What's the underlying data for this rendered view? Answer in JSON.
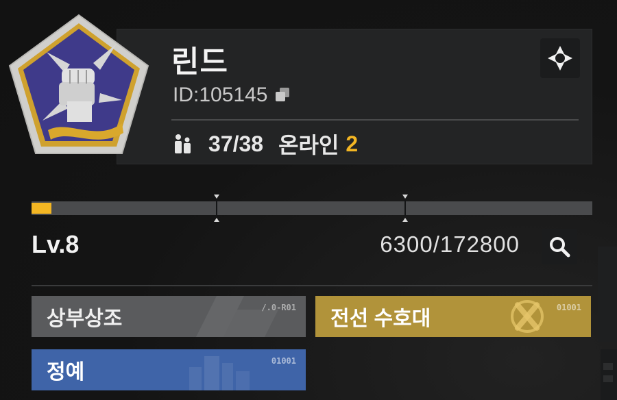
{
  "guild": {
    "name": "린드",
    "id_label": "ID:",
    "id_value": "105145",
    "members": "37/38",
    "online_label": "온라인",
    "online_count": "2"
  },
  "level": {
    "label": "Lv.8",
    "xp": "6300/172800",
    "xp_fraction": 0.036
  },
  "tags": [
    {
      "label": "상부상조",
      "code": "/.0-R01",
      "color": "#5a5b5d"
    },
    {
      "label": "전선 수호대",
      "code": "01001",
      "color": "#b1933a"
    },
    {
      "label": "정예",
      "code": "01001",
      "color": "#3f64a8"
    }
  ],
  "icons": {
    "emblem": "fist-guild-emblem",
    "copy": "copy-icon",
    "members": "members-icon",
    "target": "target-icon",
    "search": "search-icon",
    "tag_gold": "crossed-bullets-icon"
  },
  "colors": {
    "accent": "#f3b623",
    "emblem_bg": "#3f3a8a",
    "emblem_border": "#d2a72f"
  }
}
